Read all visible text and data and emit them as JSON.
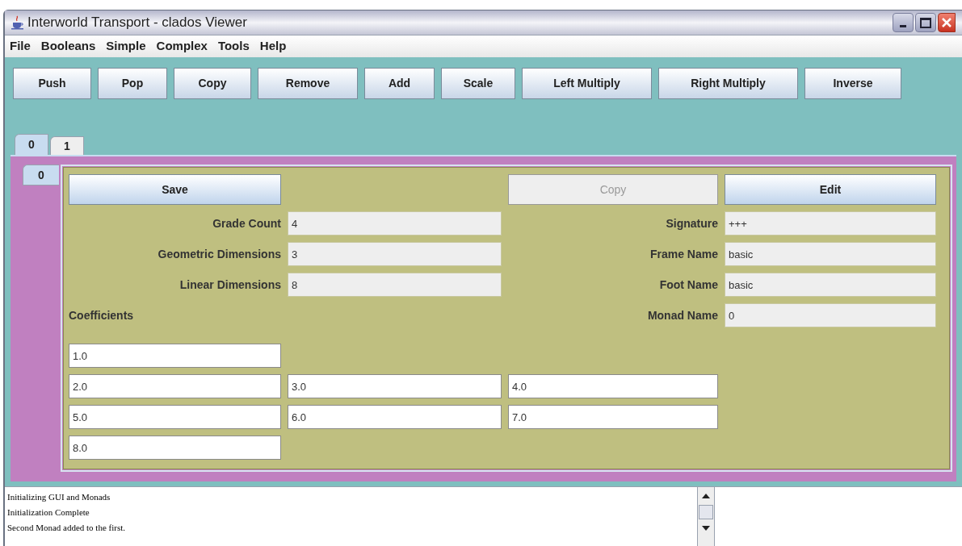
{
  "window": {
    "title": "Interworld Transport - clados Viewer"
  },
  "menu": [
    "File",
    "Booleans",
    "Simple",
    "Complex",
    "Tools",
    "Help"
  ],
  "toolbar": [
    "Push",
    "Pop",
    "Copy",
    "Remove",
    "Add",
    "Scale",
    "Left Multiply",
    "Right Multiply",
    "Inverse"
  ],
  "tabs": [
    {
      "label": "0",
      "selected": true
    },
    {
      "label": "1",
      "selected": false
    }
  ],
  "inner_tabs": [
    {
      "label": "0",
      "selected": true
    }
  ],
  "panel_buttons": [
    {
      "label": "Save",
      "disabled": false
    },
    {
      "label": "Copy",
      "disabled": true
    },
    {
      "label": "Edit",
      "disabled": false
    }
  ],
  "left_fields": [
    {
      "label": "Grade Count",
      "value": "4"
    },
    {
      "label": "Geometric Dimensions",
      "value": "3"
    },
    {
      "label": "Linear Dimensions",
      "value": "8"
    }
  ],
  "right_fields": [
    {
      "label": "Signature",
      "value": "+++"
    },
    {
      "label": "Frame Name",
      "value": "basic"
    },
    {
      "label": "Foot Name",
      "value": "basic"
    },
    {
      "label": "Monad Name",
      "value": "0"
    }
  ],
  "coefficients": {
    "label": "Coefficients",
    "rows": [
      [
        "1.0"
      ],
      [
        "2.0",
        "3.0",
        "4.0"
      ],
      [
        "5.0",
        "6.0",
        "7.0"
      ],
      [
        "8.0"
      ]
    ]
  },
  "log": [
    "Initializing GUI and Monads",
    "Initialization Complete",
    "Second Monad added to the first."
  ]
}
